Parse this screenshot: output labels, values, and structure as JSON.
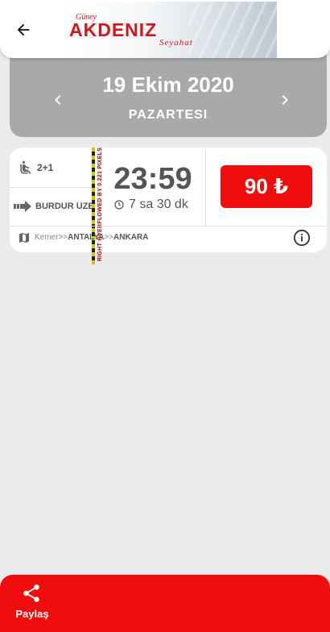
{
  "header": {
    "logo": {
      "top_text": "Güney",
      "main_text": "AKDENIZ",
      "sub_text": "Seyahat"
    }
  },
  "date_bar": {
    "date": "19 Ekim 2020",
    "weekday": "PAZARTESI"
  },
  "trip": {
    "seat_layout": "2+1",
    "route_label": "BURDUR ÜZE",
    "overflow_warning": "RIGHT OVERFLOWED BY 0.221 PIXELS",
    "departure_time": "23:59",
    "duration": "7 sa 30 dk",
    "price": "90 ₺",
    "path": {
      "origin": "Kemer",
      "sep1": ">>",
      "via": "ANTALYA",
      "sep2": ">>",
      "destination": "ANKARA"
    }
  },
  "footer": {
    "share_label": "Paylaş"
  },
  "colors": {
    "accent_red": "#f00d0d",
    "date_bar_gray": "#a9a9a9",
    "background": "#ebebeb"
  }
}
